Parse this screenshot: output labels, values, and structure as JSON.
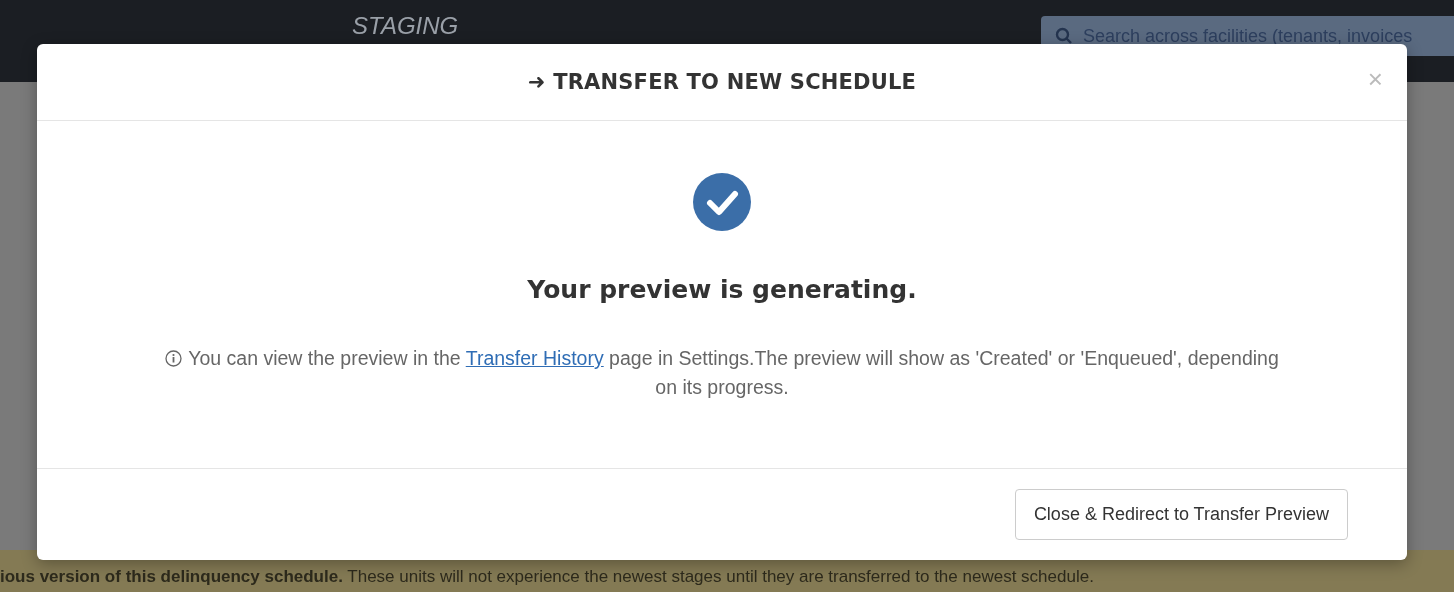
{
  "header": {
    "environment": "STAGING",
    "search": {
      "placeholder": "Search across facilities (tenants, invoices"
    }
  },
  "banner": {
    "text": "**ious version of this delinquency schedule.** These units will not experience the newest stages until they are transferred to the newest schedule."
  },
  "modal": {
    "title": "➜ TRANSFER TO NEW SCHEDULE",
    "close": "×",
    "heading": "Your preview is generating.",
    "info": {
      "before": "You can view the preview in the ",
      "link": "Transfer History",
      "after": " page in Settings.The preview will show as 'Created' or 'Enqueued', depending on its progress."
    },
    "buttons": [
      "Close & Redirect to Transfer Preview"
    ]
  }
}
